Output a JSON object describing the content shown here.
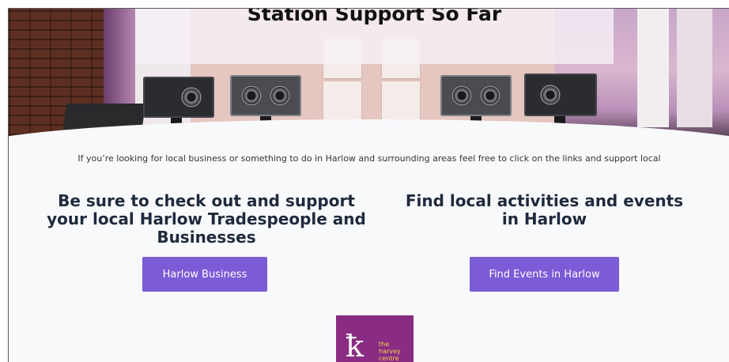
{
  "hero": {
    "title": "Station Support So Far"
  },
  "intro": {
    "text": "If you’re looking for local business or something to do in Harlow and surrounding areas feel free to click on the links and support local"
  },
  "left_column": {
    "heading": "Be sure to check out and support your local Harlow Tradespeople and Businesses",
    "button_label": "Harlow Business"
  },
  "right_column": {
    "heading": "Find local activities and events in Harlow",
    "button_label": "Find Events in Harlow"
  },
  "partner_logo": {
    "line1": "the",
    "line2": "harvey",
    "line3": "centre"
  },
  "colors": {
    "accent_button": "#7b5bd6",
    "heading_text": "#1f2a3d",
    "logo_bg": "#8a2c83"
  }
}
